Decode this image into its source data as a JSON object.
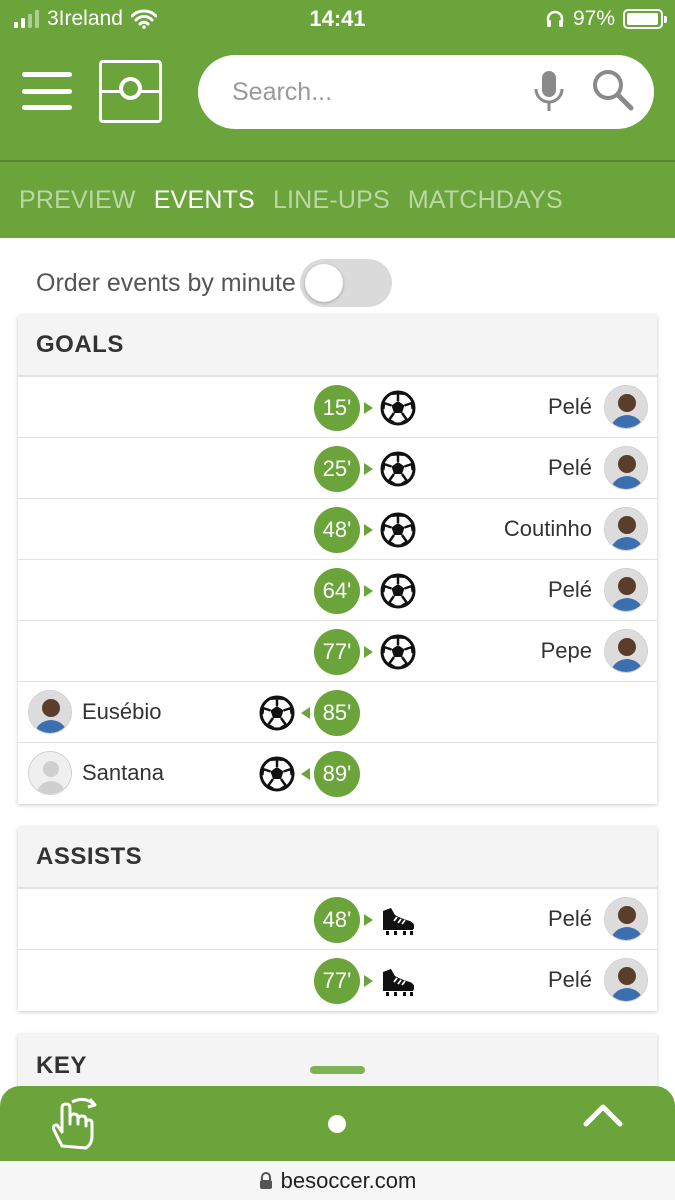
{
  "status_bar": {
    "carrier": "3Ireland",
    "time": "14:41",
    "battery": "97%",
    "battery_level": 0.97
  },
  "header": {
    "search_placeholder": "Search..."
  },
  "tabs": [
    {
      "label": "PREVIEW",
      "active": false
    },
    {
      "label": "EVENTS",
      "active": true
    },
    {
      "label": "LINE-UPS",
      "active": false
    },
    {
      "label": "MATCHDAYS",
      "active": false
    }
  ],
  "order_toggle": {
    "label": "Order events by minute",
    "on": false
  },
  "goals": {
    "title": "GOALS",
    "events": [
      {
        "minute": "15'",
        "player": "Pelé",
        "side": "away",
        "icon": "soccer-ball-icon"
      },
      {
        "minute": "25'",
        "player": "Pelé",
        "side": "away",
        "icon": "soccer-ball-icon"
      },
      {
        "minute": "48'",
        "player": "Coutinho",
        "side": "away",
        "icon": "soccer-ball-icon"
      },
      {
        "minute": "64'",
        "player": "Pelé",
        "side": "away",
        "icon": "soccer-ball-icon"
      },
      {
        "minute": "77'",
        "player": "Pepe",
        "side": "away",
        "icon": "soccer-ball-icon"
      },
      {
        "minute": "85'",
        "player": "Eusébio",
        "side": "home",
        "icon": "soccer-ball-icon"
      },
      {
        "minute": "89'",
        "player": "Santana",
        "side": "home",
        "icon": "soccer-ball-icon"
      }
    ]
  },
  "assists": {
    "title": "ASSISTS",
    "events": [
      {
        "minute": "48'",
        "player": "Pelé",
        "side": "away",
        "icon": "football-boot-icon"
      },
      {
        "minute": "77'",
        "player": "Pelé",
        "side": "away",
        "icon": "football-boot-icon"
      }
    ]
  },
  "key": {
    "title": "KEY"
  },
  "browser": {
    "url": "besoccer.com"
  },
  "colors": {
    "brand_green": "#6aa43b",
    "divider_green": "#55852e"
  }
}
